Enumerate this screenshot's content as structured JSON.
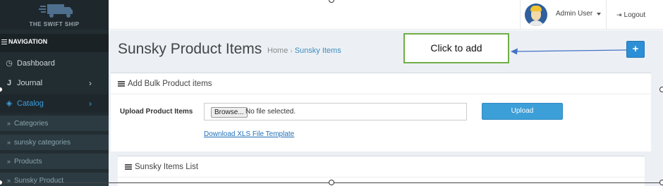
{
  "logo": {
    "text": "THE SWIFT SHIP"
  },
  "sidebar": {
    "header": "NAVIGATION",
    "items": [
      {
        "label": "Dashboard",
        "icon": "dashboard-icon"
      },
      {
        "label": "Journal",
        "icon": "journal-icon"
      },
      {
        "label": "Catalog",
        "icon": "tag-icon",
        "active": true
      }
    ],
    "subitems": [
      {
        "label": "Categories"
      },
      {
        "label": "sunsky categories"
      },
      {
        "label": "Products"
      },
      {
        "label": "Sunsky Product"
      }
    ]
  },
  "topbar": {
    "user_name": "Admin User",
    "logout_label": "Logout"
  },
  "page": {
    "title": "Sunsky Product Items",
    "breadcrumb": {
      "home": "Home",
      "current": "Sunsky Items"
    },
    "add_button": "+"
  },
  "annotation": {
    "text": "Click to add"
  },
  "bulk": {
    "title": "Add Bulk Product items",
    "upload_label": "Upload Product Items",
    "browse_label": "Browse...",
    "file_status": "No file selected.",
    "upload_button": "Upload",
    "download_link": "Download XLS File Template"
  },
  "list": {
    "title": "Sunsky Items List"
  },
  "colors": {
    "sidebar_bg": "#222d32",
    "accent": "#3c8dbc",
    "annotation_border": "#70ad47",
    "arrow": "#4472c4"
  }
}
